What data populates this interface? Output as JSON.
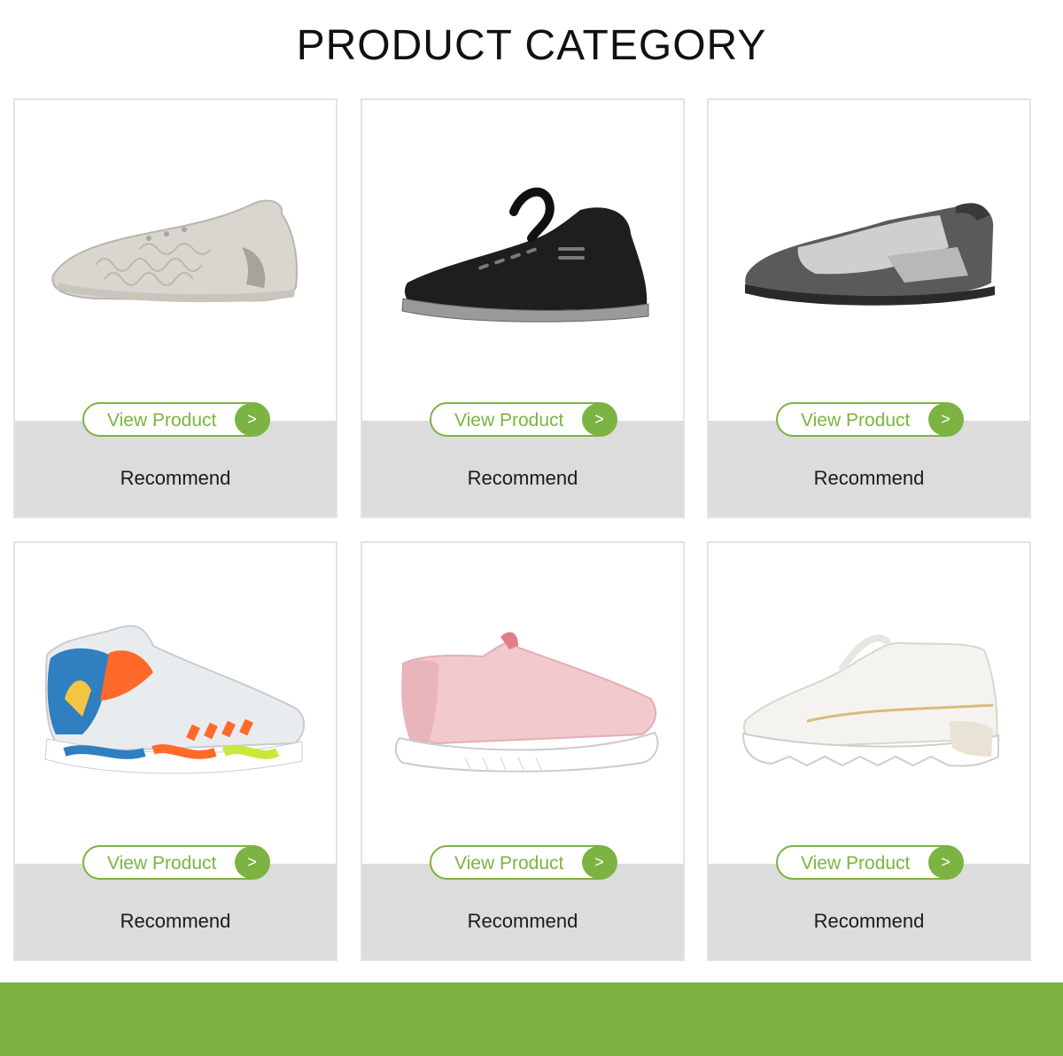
{
  "page_title": "PRODUCT CATEGORY",
  "colors": {
    "accent": "#7cb342",
    "card_band": "#dcdcdc",
    "card_border": "#e3e3e3"
  },
  "products": [
    {
      "button_label": "View Product",
      "button_arrow": ">",
      "caption": "Recommend",
      "image": "white-knit-sneaker"
    },
    {
      "button_label": "View Product",
      "button_arrow": ">",
      "caption": "Recommend",
      "image": "black-sport-sneaker"
    },
    {
      "button_label": "View Product",
      "button_arrow": ">",
      "caption": "Recommend",
      "image": "grey-slip-on-shoe"
    },
    {
      "button_label": "View Product",
      "button_arrow": ">",
      "caption": "Recommend",
      "image": "multicolor-basketball-shoe"
    },
    {
      "button_label": "View Product",
      "button_arrow": ">",
      "caption": "Recommend",
      "image": "pink-slip-on-sneaker"
    },
    {
      "button_label": "View Product",
      "button_arrow": ">",
      "caption": "Recommend",
      "image": "white-chunky-sneaker"
    }
  ]
}
